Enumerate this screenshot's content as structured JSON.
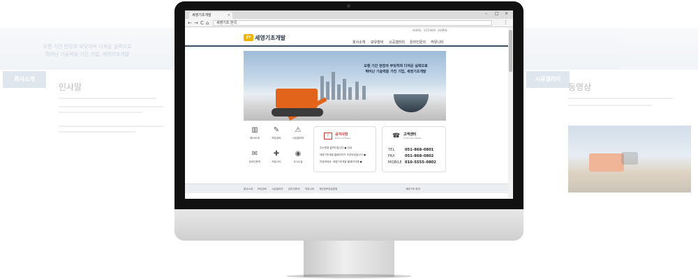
{
  "colors": {
    "brand_dark": "#3a4f66",
    "accent_orange": "#e2641a",
    "notice_red": "#cc3333",
    "logo_yellow": "#f0b400"
  },
  "ghost_left": {
    "banner_line1": "오랜 기간 현장과 부딪히며 다져온 실력으로",
    "banner_line2": "뛰어난 기술력을 가진 기업, 세영기초개발",
    "side_title": "회사소개",
    "page_title": "인사말"
  },
  "ghost_right": {
    "side_title": "시공갤러리",
    "page_title": "동영상"
  },
  "browser": {
    "tab_title": "세영기초개발",
    "tab_close": "×",
    "url": "세영기초.한국",
    "back": "←",
    "forward": "→",
    "reload": "C",
    "home": "⌂",
    "menu": "⋮",
    "win_min": "–",
    "win_max": "□",
    "win_close": "×"
  },
  "site": {
    "util_links": [
      "HOME",
      "SITEMAP",
      "ADMIN"
    ],
    "logo_mark": "SY",
    "logo_text": "세영기초개발",
    "nav": [
      "회사소개",
      "보유장비",
      "시공갤러리",
      "온라인문의",
      "커뮤니티"
    ],
    "hero_line1": "오랜 기간 현장과 부딪히며 다져온 실력으로",
    "hero_line2": "뛰어난 기술력을 가진 기업, 세영기초개발",
    "quick_links": [
      {
        "icon": "building-icon",
        "glyph": "▥",
        "label": "회사소개"
      },
      {
        "icon": "wrench-icon",
        "glyph": "✎",
        "label": "보유장비"
      },
      {
        "icon": "crane-icon",
        "glyph": "⚠",
        "label": "시공갤러리"
      },
      {
        "icon": "message-icon",
        "glyph": "✉",
        "label": "온라인문의"
      },
      {
        "icon": "gift-icon",
        "glyph": "✚",
        "label": "커뮤니티"
      },
      {
        "icon": "location-icon",
        "glyph": "◉",
        "label": "오시는길"
      }
    ],
    "notice": {
      "title": "공지사항",
      "subtitle": "Notice & News",
      "items": [
        "주소변경 알려드립니다 ● 안내",
        "세영기초개발 홈페이지가 오픈되었습니다 ●",
        "안녕하세요. 세영기초개발 홈페이지에 ●"
      ]
    },
    "contact": {
      "title": "고객센터",
      "subtitle": "Customer Center",
      "rows": [
        {
          "label": "TEL",
          "value": "051–868–0801"
        },
        {
          "label": "FAX",
          "value": "051–868–0802"
        },
        {
          "label": "MOBILE",
          "value": "010–5555–0802"
        }
      ]
    },
    "footer_links": [
      "회사소개",
      "보유장비",
      "시공갤러리",
      "온라인문의",
      "커뮤니티",
      "개인정보취급방침"
    ],
    "footer_right": "세영기초.한국"
  }
}
